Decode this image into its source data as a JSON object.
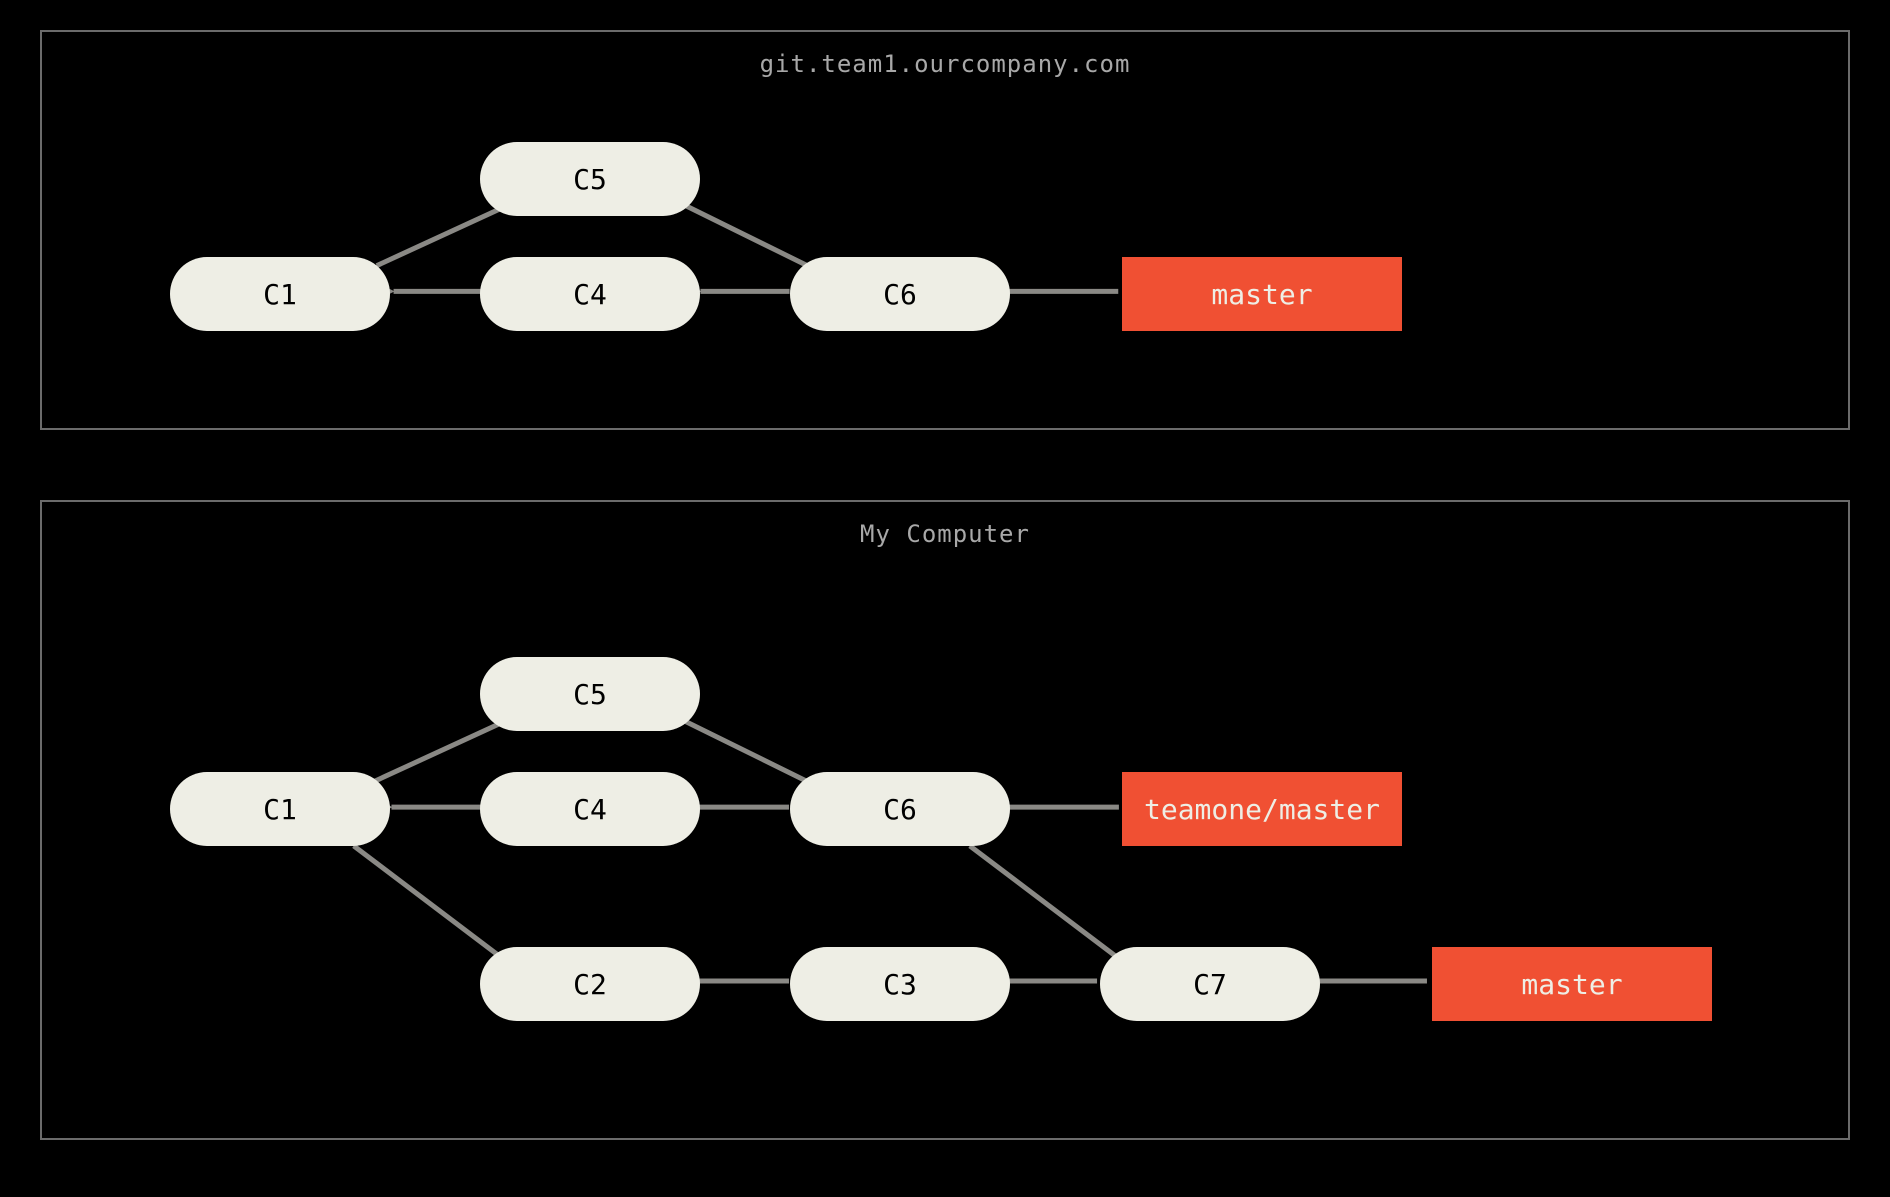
{
  "colors": {
    "background": "#000000",
    "commit_node": "#eeeee5",
    "branch_node": "#f05033",
    "arrow": "#8a8985",
    "border": "#6b6b6b",
    "title_text": "#a8a8a8"
  },
  "panels": {
    "top": {
      "title": "git.team1.ourcompany.com",
      "commits": {
        "c1": "C1",
        "c4": "C4",
        "c5": "C5",
        "c6": "C6"
      },
      "branches": {
        "master": "master"
      },
      "edges": [
        {
          "from": "C5",
          "to": "C1"
        },
        {
          "from": "C4",
          "to": "C1"
        },
        {
          "from": "C6",
          "to": "C5"
        },
        {
          "from": "C6",
          "to": "C4"
        },
        {
          "from": "master",
          "to": "C6"
        }
      ]
    },
    "bottom": {
      "title": "My Computer",
      "commits": {
        "c1": "C1",
        "c2": "C2",
        "c3": "C3",
        "c4": "C4",
        "c5": "C5",
        "c6": "C6",
        "c7": "C7"
      },
      "branches": {
        "teamone_master": "teamone/master",
        "master": "master"
      },
      "edges": [
        {
          "from": "C5",
          "to": "C1"
        },
        {
          "from": "C4",
          "to": "C1"
        },
        {
          "from": "C6",
          "to": "C5"
        },
        {
          "from": "C6",
          "to": "C4"
        },
        {
          "from": "teamone/master",
          "to": "C6"
        },
        {
          "from": "C2",
          "to": "C1"
        },
        {
          "from": "C3",
          "to": "C2"
        },
        {
          "from": "C7",
          "to": "C3"
        },
        {
          "from": "C7",
          "to": "C6"
        },
        {
          "from": "master",
          "to": "C7"
        }
      ]
    }
  }
}
